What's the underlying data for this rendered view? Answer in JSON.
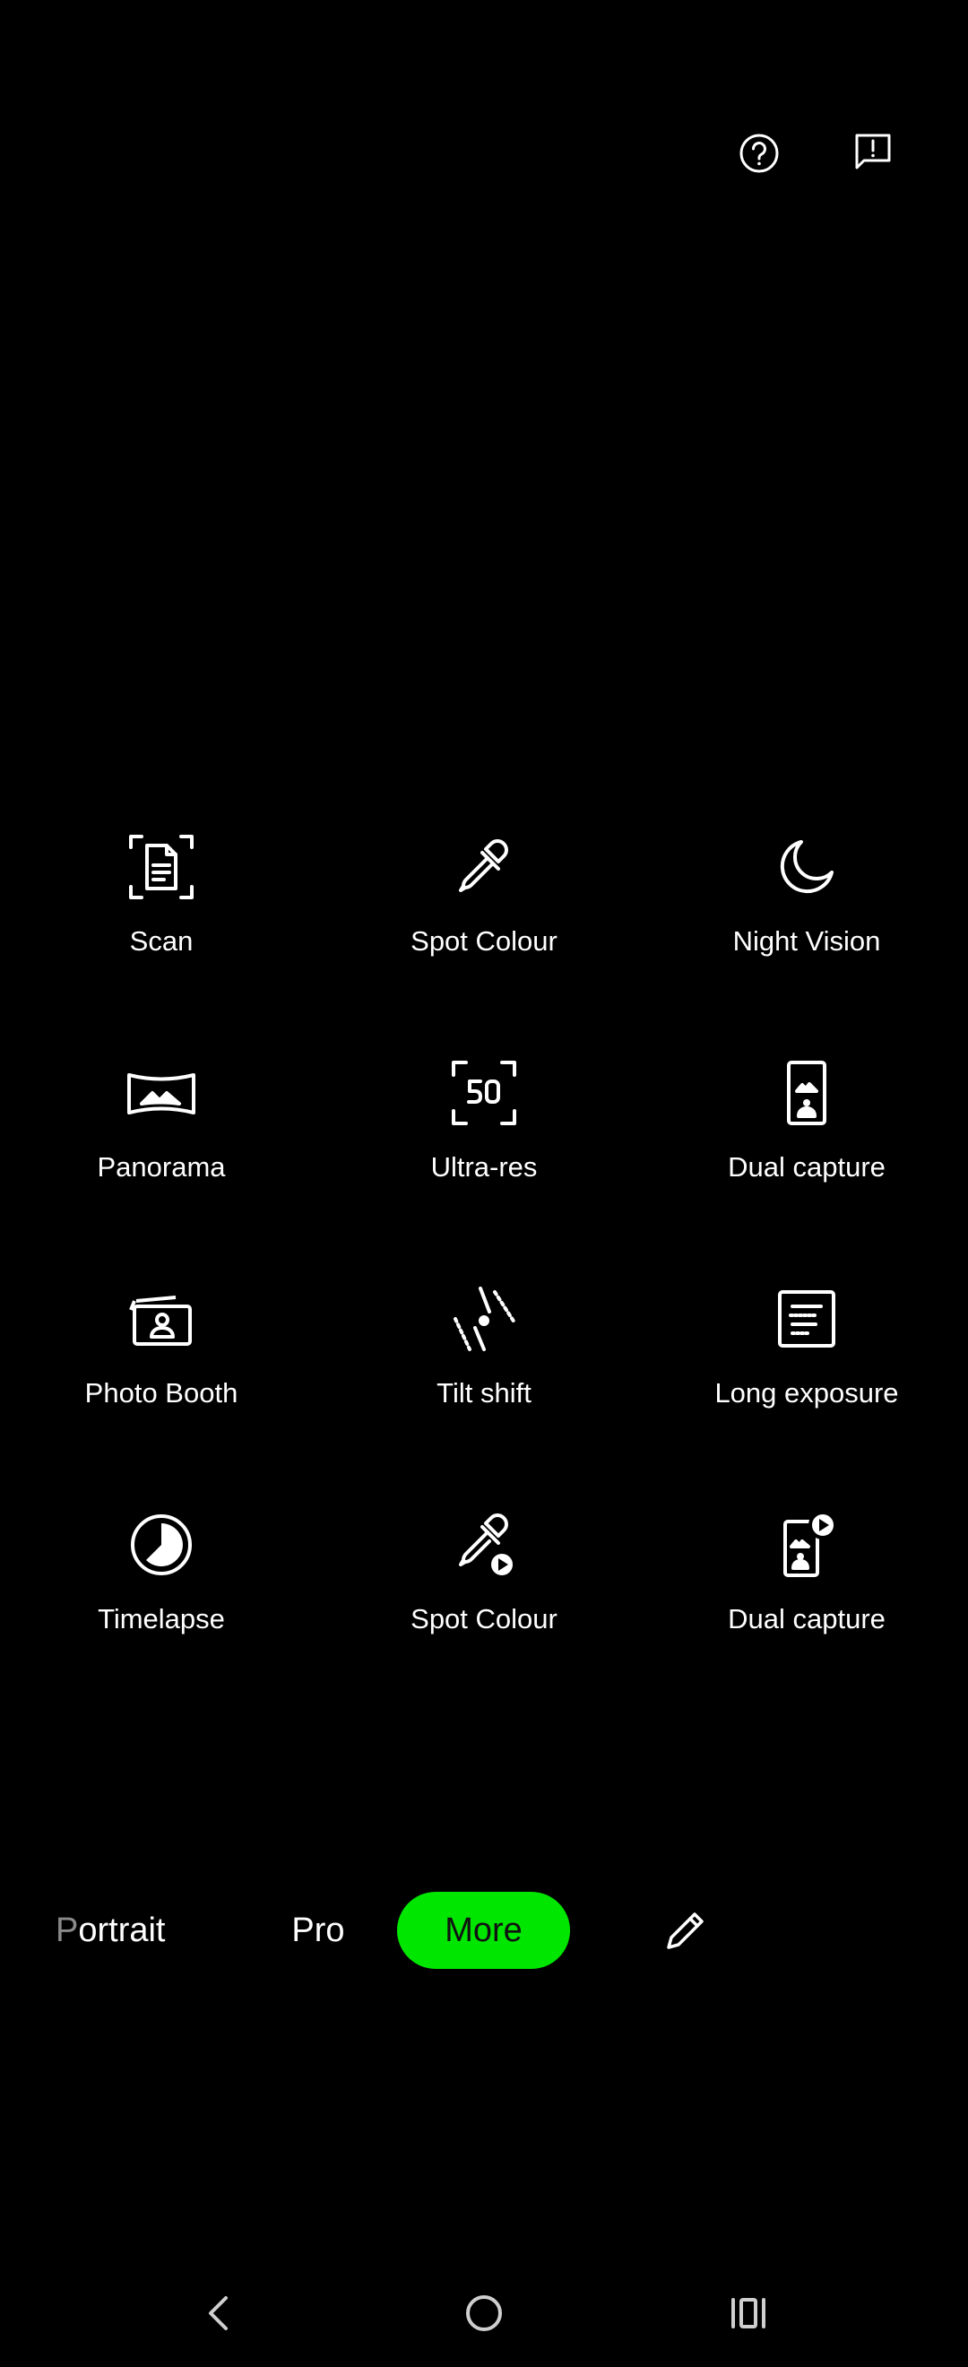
{
  "top_bar": {
    "help_icon": "question-circle-icon",
    "feedback_icon": "feedback-icon"
  },
  "modes": [
    {
      "label": "Scan",
      "icon": "scan-document-icon"
    },
    {
      "label": "Spot Colour",
      "icon": "eyedropper-icon"
    },
    {
      "label": "Night Vision",
      "icon": "moon-icon"
    },
    {
      "label": "Panorama",
      "icon": "panorama-icon"
    },
    {
      "label": "Ultra-res",
      "icon": "ultra-res-50-icon"
    },
    {
      "label": "Dual capture",
      "icon": "dual-capture-icon"
    },
    {
      "label": "Photo Booth",
      "icon": "photo-booth-icon"
    },
    {
      "label": "Tilt shift",
      "icon": "tilt-shift-icon"
    },
    {
      "label": "Long exposure",
      "icon": "long-exposure-icon"
    },
    {
      "label": "Timelapse",
      "icon": "timelapse-icon"
    },
    {
      "label": "Spot Colour",
      "icon": "eyedropper-video-icon"
    },
    {
      "label": "Dual capture",
      "icon": "dual-capture-video-icon"
    }
  ],
  "mode_bar": {
    "portrait_first": "P",
    "portrait_rest": "ortrait",
    "pro": "Pro",
    "more": "More",
    "active_color": "#00e600",
    "edit_icon": "pencil-icon"
  },
  "nav_bar": {
    "back_icon": "back-chevron-icon",
    "home_icon": "home-circle-icon",
    "recents_icon": "recents-icon"
  }
}
